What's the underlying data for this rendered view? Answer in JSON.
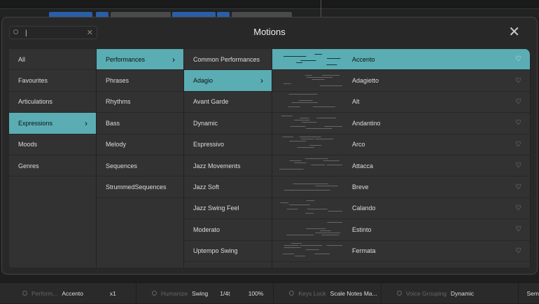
{
  "dialog": {
    "title": "Motions",
    "search": {
      "value": "|",
      "clear_icon": "close-icon"
    },
    "close_icon": "close-icon"
  },
  "accent": "#5aadb3",
  "columns": {
    "categories": [
      {
        "label": "All"
      },
      {
        "label": "Favourites"
      },
      {
        "label": "Articulations"
      },
      {
        "label": "Expressions",
        "selected": true
      },
      {
        "label": "Moods"
      },
      {
        "label": "Genres"
      }
    ],
    "subcategories": [
      {
        "label": "Performances",
        "selected": true
      },
      {
        "label": "Phrases"
      },
      {
        "label": "Rhythms"
      },
      {
        "label": "Bass"
      },
      {
        "label": "Melody"
      },
      {
        "label": "Sequences"
      },
      {
        "label": "StrummedSequences"
      }
    ],
    "groups": [
      {
        "label": "Common Performances"
      },
      {
        "label": "Adagio",
        "selected": true
      },
      {
        "label": "Avant Garde"
      },
      {
        "label": "Dynamic"
      },
      {
        "label": "Espressivo"
      },
      {
        "label": "Jazz Movements"
      },
      {
        "label": "Jazz Soft"
      },
      {
        "label": "Jazz Swing Feel"
      },
      {
        "label": "Moderato"
      },
      {
        "label": "Uptempo Swing"
      }
    ],
    "motions": [
      {
        "label": "Accento",
        "selected": true
      },
      {
        "label": "Adagietto"
      },
      {
        "label": "Alt"
      },
      {
        "label": "Andantino"
      },
      {
        "label": "Arco"
      },
      {
        "label": "Attacca"
      },
      {
        "label": "Breve"
      },
      {
        "label": "Calando"
      },
      {
        "label": "Estinto"
      },
      {
        "label": "Fermata"
      }
    ]
  },
  "bottom_bar": {
    "performance": {
      "label": "Perform...",
      "value": "Accento",
      "extra": "x1"
    },
    "humanize": {
      "label": "Humanize",
      "value": "Swing",
      "division": "1/4t",
      "amount": "100%"
    },
    "keys_lock": {
      "label": "Keys Lock",
      "value": "Scale Notes Ma..."
    },
    "voice_grouping": {
      "label": "Voice Grouping",
      "value": "Dynamic"
    },
    "cut": "Sem"
  }
}
